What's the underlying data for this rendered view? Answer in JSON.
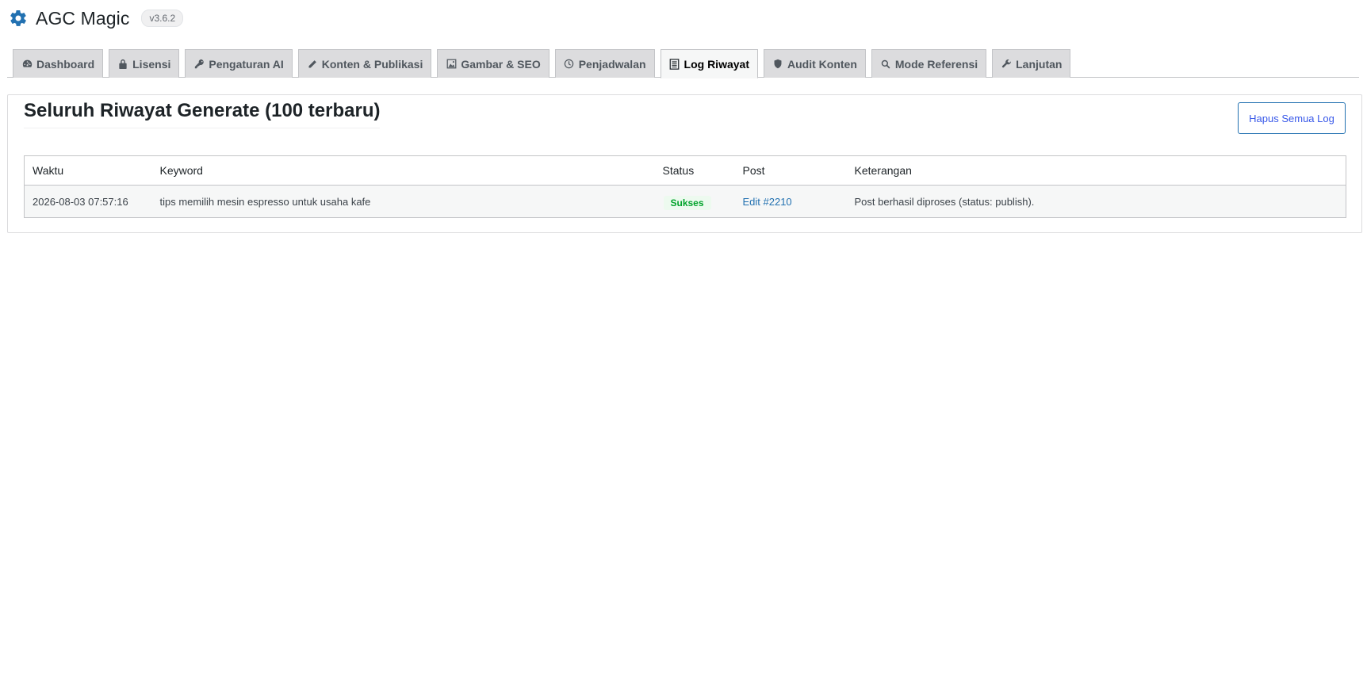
{
  "app": {
    "title": "AGC Magic",
    "version": "v3.6.2",
    "logo_icon": "gear-icon",
    "accent": "#2271b1"
  },
  "tabs": [
    {
      "label": "Dashboard",
      "icon": "dashboard-icon",
      "active": false
    },
    {
      "label": "Lisensi",
      "icon": "lock-icon",
      "active": false
    },
    {
      "label": "Pengaturan AI",
      "icon": "key-icon",
      "active": false
    },
    {
      "label": "Konten & Publikasi",
      "icon": "pencil-icon",
      "active": false
    },
    {
      "label": "Gambar & SEO",
      "icon": "image-icon",
      "active": false
    },
    {
      "label": "Penjadwalan",
      "icon": "clock-icon",
      "active": false
    },
    {
      "label": "Log Riwayat",
      "icon": "list-icon",
      "active": true
    },
    {
      "label": "Audit Konten",
      "icon": "shield-icon",
      "active": false
    },
    {
      "label": "Mode Referensi",
      "icon": "search-icon",
      "active": false
    },
    {
      "label": "Lanjutan",
      "icon": "wrench-icon",
      "active": false
    }
  ],
  "log_panel": {
    "title": "Seluruh Riwayat Generate (100 terbaru)",
    "clear_button": "Hapus Semua Log",
    "columns": [
      "Waktu",
      "Keyword",
      "Status",
      "Post",
      "Keterangan"
    ],
    "rows": [
      {
        "time": "2026-08-03 07:57:16",
        "keyword": "tips memilih mesin espresso untuk usaha kafe",
        "status": "Sukses",
        "post": "Edit #2210",
        "note": "Post berhasil diproses (status: publish)."
      }
    ]
  }
}
